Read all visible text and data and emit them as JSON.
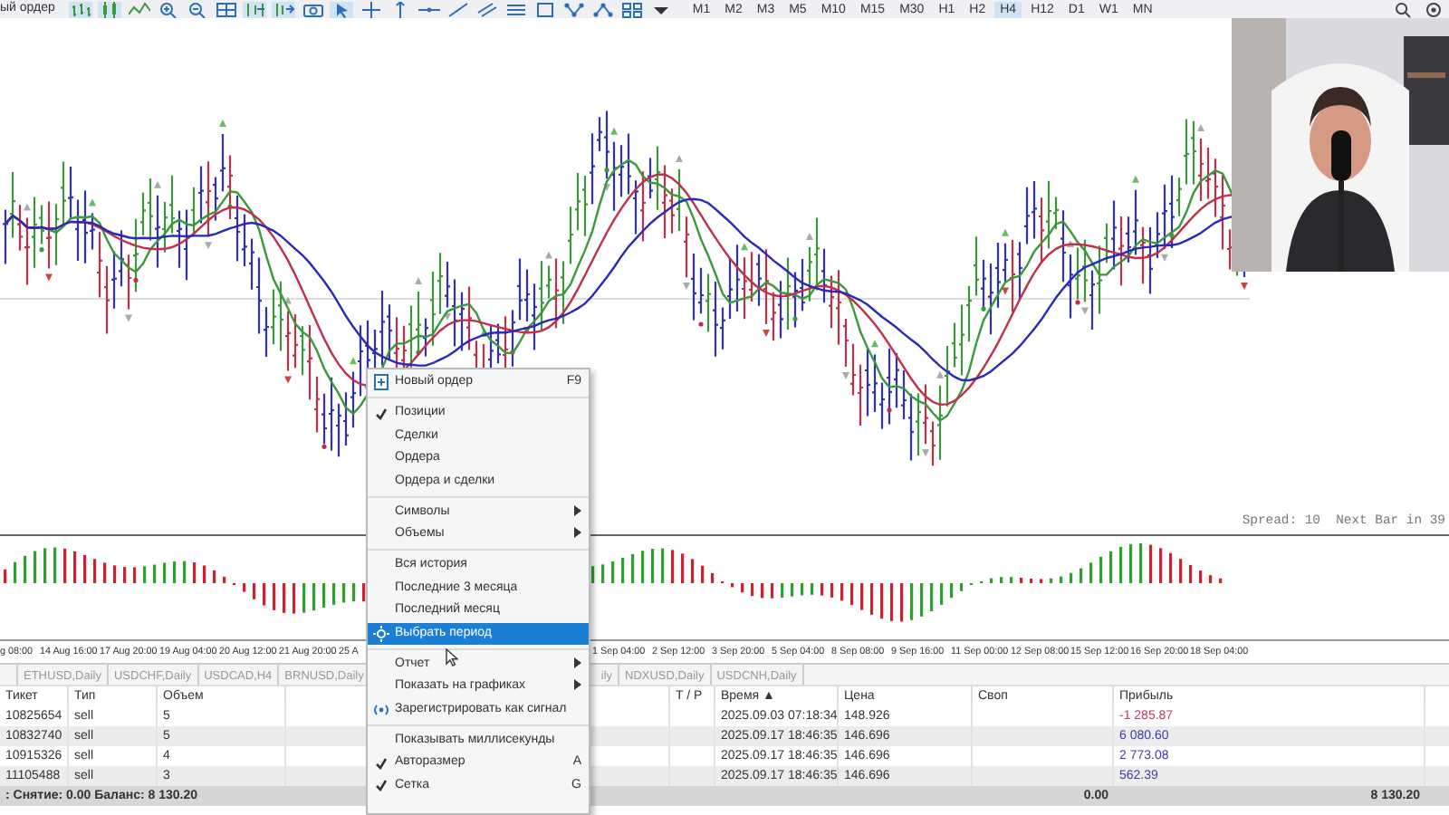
{
  "toolbar": {
    "cut_label": "ый ордер",
    "timeframes": [
      {
        "label": "M1",
        "selected": false
      },
      {
        "label": "M2",
        "selected": false
      },
      {
        "label": "M3",
        "selected": false
      },
      {
        "label": "M5",
        "selected": false
      },
      {
        "label": "M10",
        "selected": false
      },
      {
        "label": "M15",
        "selected": false
      },
      {
        "label": "M30",
        "selected": false
      },
      {
        "label": "H1",
        "selected": false
      },
      {
        "label": "H2",
        "selected": false
      },
      {
        "label": "H4",
        "selected": true
      },
      {
        "label": "H12",
        "selected": false
      },
      {
        "label": "D1",
        "selected": false
      },
      {
        "label": "W1",
        "selected": false
      },
      {
        "label": "MN",
        "selected": false
      }
    ]
  },
  "chart": {
    "status": "Spread: 10  Next Bar in 39"
  },
  "time_axis": {
    "left": [
      "g 08:00",
      "14 Aug 16:00",
      "17 Aug 20:00",
      "19 Aug 04:00",
      "20 Aug 12:00",
      "21 Aug 20:00",
      "25 A"
    ],
    "right": [
      "1 Sep 04:00",
      "2 Sep 12:00",
      "3 Sep 20:00",
      "5 Sep 04:00",
      "8 Sep 08:00",
      "9 Sep 16:00",
      "11 Sep 00:00",
      "12 Sep 08:00",
      "15 Sep 12:00",
      "16 Sep 20:00",
      "18 Sep 04:00"
    ]
  },
  "symbol_tabs": {
    "left": [
      "ETHUSD,Daily",
      "USDCHF,Daily",
      "USDCAD,H4",
      "BRNUSD,Daily"
    ],
    "right": [
      "ily",
      "NDXUSD,Daily",
      "USDCNH,Daily"
    ]
  },
  "table": {
    "columns": [
      "Тикет",
      "Тип",
      "Объем",
      "T / P",
      "Время ▲",
      "Цена",
      "Своп",
      "Прибыль"
    ],
    "rows": [
      {
        "ticket": "10825654",
        "type": "sell",
        "volume": "5",
        "time": "2025.09.03 07:18:34",
        "price": "148.926",
        "profit": "-1 285.87",
        "color": "#c2385a"
      },
      {
        "ticket": "10832740",
        "type": "sell",
        "volume": "5",
        "time": "2025.09.17 18:46:35",
        "price": "146.696",
        "profit": "6 080.60",
        "color": "#3c3ca8"
      },
      {
        "ticket": "10915326",
        "type": "sell",
        "volume": "4",
        "time": "2025.09.17 18:46:35",
        "price": "146.696",
        "profit": "2 773.08",
        "color": "#3c3ca8"
      },
      {
        "ticket": "11105488",
        "type": "sell",
        "volume": "3",
        "time": "2025.09.17 18:46:35",
        "price": "146.696",
        "profit": "562.39",
        "color": "#3c3ca8"
      }
    ],
    "summary": {
      "balance": ": Снятие: 0.00  Баланс: 8 130.20",
      "swap": "0.00",
      "profit": "8 130.20"
    }
  },
  "context_menu": {
    "sections": [
      [
        {
          "label": "Новый ордер",
          "shortcut": "F9",
          "kind": "order",
          "checked": false,
          "submenu": false,
          "selected": false
        }
      ],
      [
        {
          "label": "Позиции",
          "kind": "plain",
          "checked": true,
          "submenu": false,
          "selected": false
        },
        {
          "label": "Сделки",
          "kind": "plain",
          "checked": false,
          "submenu": false,
          "selected": false
        },
        {
          "label": "Ордера",
          "kind": "plain",
          "checked": false,
          "submenu": false,
          "selected": false
        },
        {
          "label": "Ордера и сделки",
          "kind": "plain",
          "checked": false,
          "submenu": false,
          "selected": false
        }
      ],
      [
        {
          "label": "Символы",
          "kind": "plain",
          "checked": false,
          "submenu": true,
          "selected": false
        },
        {
          "label": "Объемы",
          "kind": "plain",
          "checked": false,
          "submenu": true,
          "selected": false
        }
      ],
      [
        {
          "label": "Вся история",
          "kind": "plain",
          "checked": false,
          "submenu": false,
          "selected": false
        },
        {
          "label": "Последние 3 месяца",
          "kind": "plain",
          "checked": false,
          "submenu": false,
          "selected": false
        },
        {
          "label": "Последний месяц",
          "kind": "plain",
          "checked": false,
          "submenu": false,
          "selected": false
        },
        {
          "label": "Выбрать период",
          "kind": "period",
          "checked": false,
          "submenu": false,
          "selected": true
        }
      ],
      [
        {
          "label": "Отчет",
          "kind": "plain",
          "checked": false,
          "submenu": true,
          "selected": false
        },
        {
          "label": "Показать на графиках",
          "kind": "plain",
          "checked": false,
          "submenu": true,
          "selected": false
        },
        {
          "label": "Зарегистрировать как сигнал",
          "kind": "signal",
          "checked": false,
          "submenu": false,
          "selected": false
        }
      ],
      [
        {
          "label": "Показывать миллисекунды",
          "kind": "plain",
          "checked": false,
          "submenu": false,
          "selected": false
        },
        {
          "label": "Авторазмер",
          "shortcut": "A",
          "kind": "plain",
          "checked": true,
          "submenu": false,
          "selected": false
        },
        {
          "label": "Сетка",
          "shortcut": "G",
          "kind": "plain",
          "checked": true,
          "submenu": false,
          "selected": false
        }
      ]
    ]
  }
}
